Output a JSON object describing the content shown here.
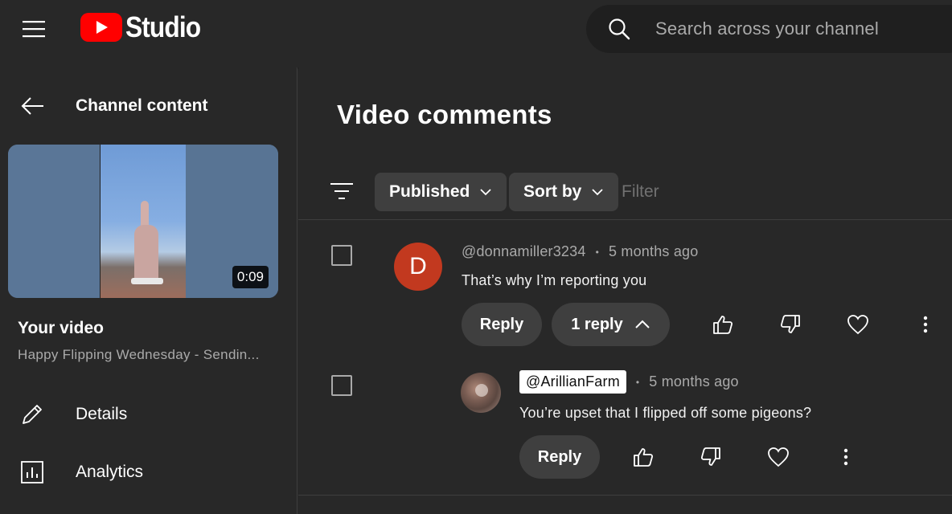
{
  "header": {
    "app_name": "Studio",
    "search_placeholder": "Search across your channel"
  },
  "sidebar": {
    "back_label": "Channel content",
    "thumbnail_duration": "0:09",
    "your_video_label": "Your video",
    "video_title": "Happy Flipping Wednesday - Sendin...",
    "nav": [
      {
        "label": "Details",
        "icon": "pencil-icon"
      },
      {
        "label": "Analytics",
        "icon": "analytics-icon"
      }
    ]
  },
  "main": {
    "title": "Video comments",
    "filters": {
      "published_label": "Published",
      "sort_label": "Sort by",
      "filter_placeholder": "Filter"
    },
    "comments": [
      {
        "avatar_letter": "D",
        "author": "@donnamiller3234",
        "time": "5 months ago",
        "text": "That’s why I’m reporting you",
        "reply_label": "Reply",
        "replies_label": "1 reply"
      },
      {
        "author": "@ArillianFarm",
        "time": "5 months ago",
        "text": "You’re upset that I flipped off some pigeons?",
        "reply_label": "Reply"
      }
    ]
  },
  "colors": {
    "background": "#282828",
    "brand_red": "#ff0000",
    "avatar_d": "#c2391f",
    "chip_bg": "#3f3f3f"
  }
}
